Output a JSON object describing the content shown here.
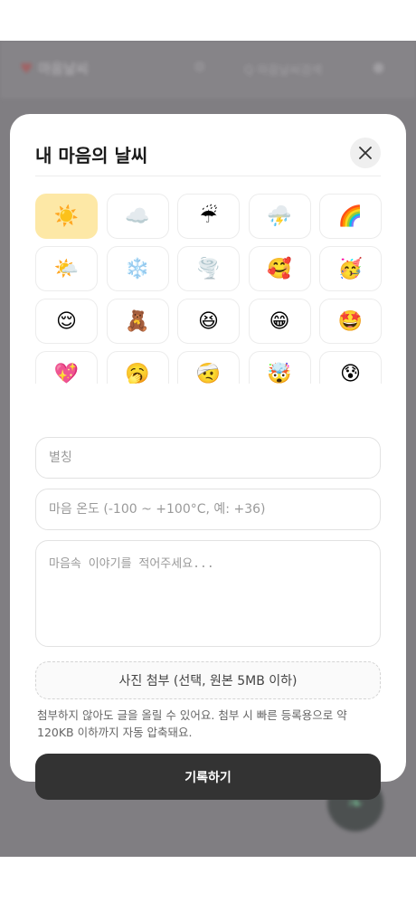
{
  "background": {
    "app_name": "마음날씨",
    "search_text": "Q 마음날씨검색",
    "fab_icon": "leaf-icon"
  },
  "modal": {
    "title": "내 마음의 날씨",
    "close_label": "✕",
    "emojis": [
      {
        "char": "☀️",
        "selected": true
      },
      {
        "char": "☁️",
        "selected": false
      },
      {
        "char": "☔",
        "selected": false
      },
      {
        "char": "⛈️",
        "selected": false
      },
      {
        "char": "🌈",
        "selected": false
      },
      {
        "char": "🌤️",
        "selected": false
      },
      {
        "char": "❄️",
        "selected": false
      },
      {
        "char": "🌪️",
        "selected": false
      },
      {
        "char": "🥰",
        "selected": false
      },
      {
        "char": "🥳",
        "selected": false
      },
      {
        "char": "😌",
        "selected": false
      },
      {
        "char": "🧸",
        "selected": false
      },
      {
        "char": "😆",
        "selected": false
      },
      {
        "char": "😁",
        "selected": false
      },
      {
        "char": "🤩",
        "selected": false
      },
      {
        "char": "💖",
        "selected": false
      },
      {
        "char": "🥱",
        "selected": false
      },
      {
        "char": "🤕",
        "selected": false
      },
      {
        "char": "🤯",
        "selected": false
      },
      {
        "char": "😰",
        "selected": false
      }
    ],
    "nickname_placeholder": "별칭",
    "nickname_value": "",
    "temperature_placeholder": "마음 온도 (-100 ~ +100°C, 예: +36)",
    "temperature_value": "",
    "story_placeholder": "마음속 이야기를 적어주세요...",
    "story_value": "",
    "photo_button_label": "사진 첨부 (선택, 원본 5MB 이하)",
    "help_text": "첨부하지 않아도 글을 올릴 수 있어요. 첨부 시 빠른 등록용으로 약 120KB 이하까지 자동 압축돼요.",
    "submit_label": "기록하기"
  },
  "colors": {
    "selected_emoji_bg": "#fde8a6",
    "submit_bg": "#333333",
    "overlay": "#8f8f8f"
  }
}
